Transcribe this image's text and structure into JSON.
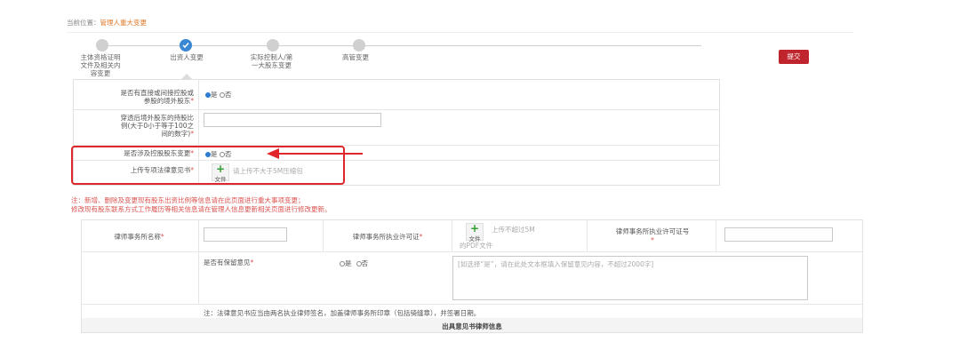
{
  "breadcrumb": {
    "prefix": "当前位置：",
    "current": "管理人重大变更"
  },
  "steps": [
    {
      "label": "主体资格证明\n文件及相关内\n容变更",
      "state": "done"
    },
    {
      "label": "出资人变更",
      "state": "active"
    },
    {
      "label": "实际控制人/第\n一大股东变更",
      "state": "pending"
    },
    {
      "label": "高管变更",
      "state": "pending"
    }
  ],
  "toolbar": {
    "submit_label": "提交"
  },
  "form": {
    "q1": {
      "label": "是否有直接或间接控股或\n参股的境外股东",
      "req": "*",
      "yes": "是",
      "no": "否"
    },
    "q2": {
      "label": "穿透后境外股东的持股比\n例(大于0小于等于100之\n间的数字)",
      "req": "*",
      "value": ""
    },
    "q3": {
      "label": "是否涉及控股股东变更",
      "req": "*",
      "yes": "是",
      "no": "否"
    },
    "q4": {
      "label": "上传专项法律意见书",
      "req": "*",
      "upload_label": "文件",
      "hint": "请上传不大于5M压缩包"
    }
  },
  "notes": {
    "line1": "注：新增、删除及变更现有股东出资比例等信息请在此页面进行重大事项变更；",
    "line2": "修改现有股东联系方式工作履历等相关信息请在管理人信息更新相关页面进行修改更新。"
  },
  "lawyer": {
    "firm_label": "律师事务所名称",
    "req": "*",
    "license_label": "律师事务所执业许可证",
    "upload_label": "文件",
    "upload_hint1": "上传不超过5M",
    "upload_hint2": "的PDF文件",
    "license_no_label": "律师事务所执业许可证号",
    "reservation_label": "是否有保留意见",
    "res_yes": "是",
    "res_no": "否",
    "textarea_placeholder": "[如选择“是”，请在此处文本框填入保留意见内容，不超过2000字]",
    "footnote": "注：法律意见书应当由两名执业律师签名，加盖律师事务所印章（包括骑缝章），并签署日期。",
    "section_title": "出具意见书律师信息"
  },
  "colors": {
    "accent": "#3a87d4",
    "submit": "#c0242d",
    "highlight": "#e0262b"
  }
}
